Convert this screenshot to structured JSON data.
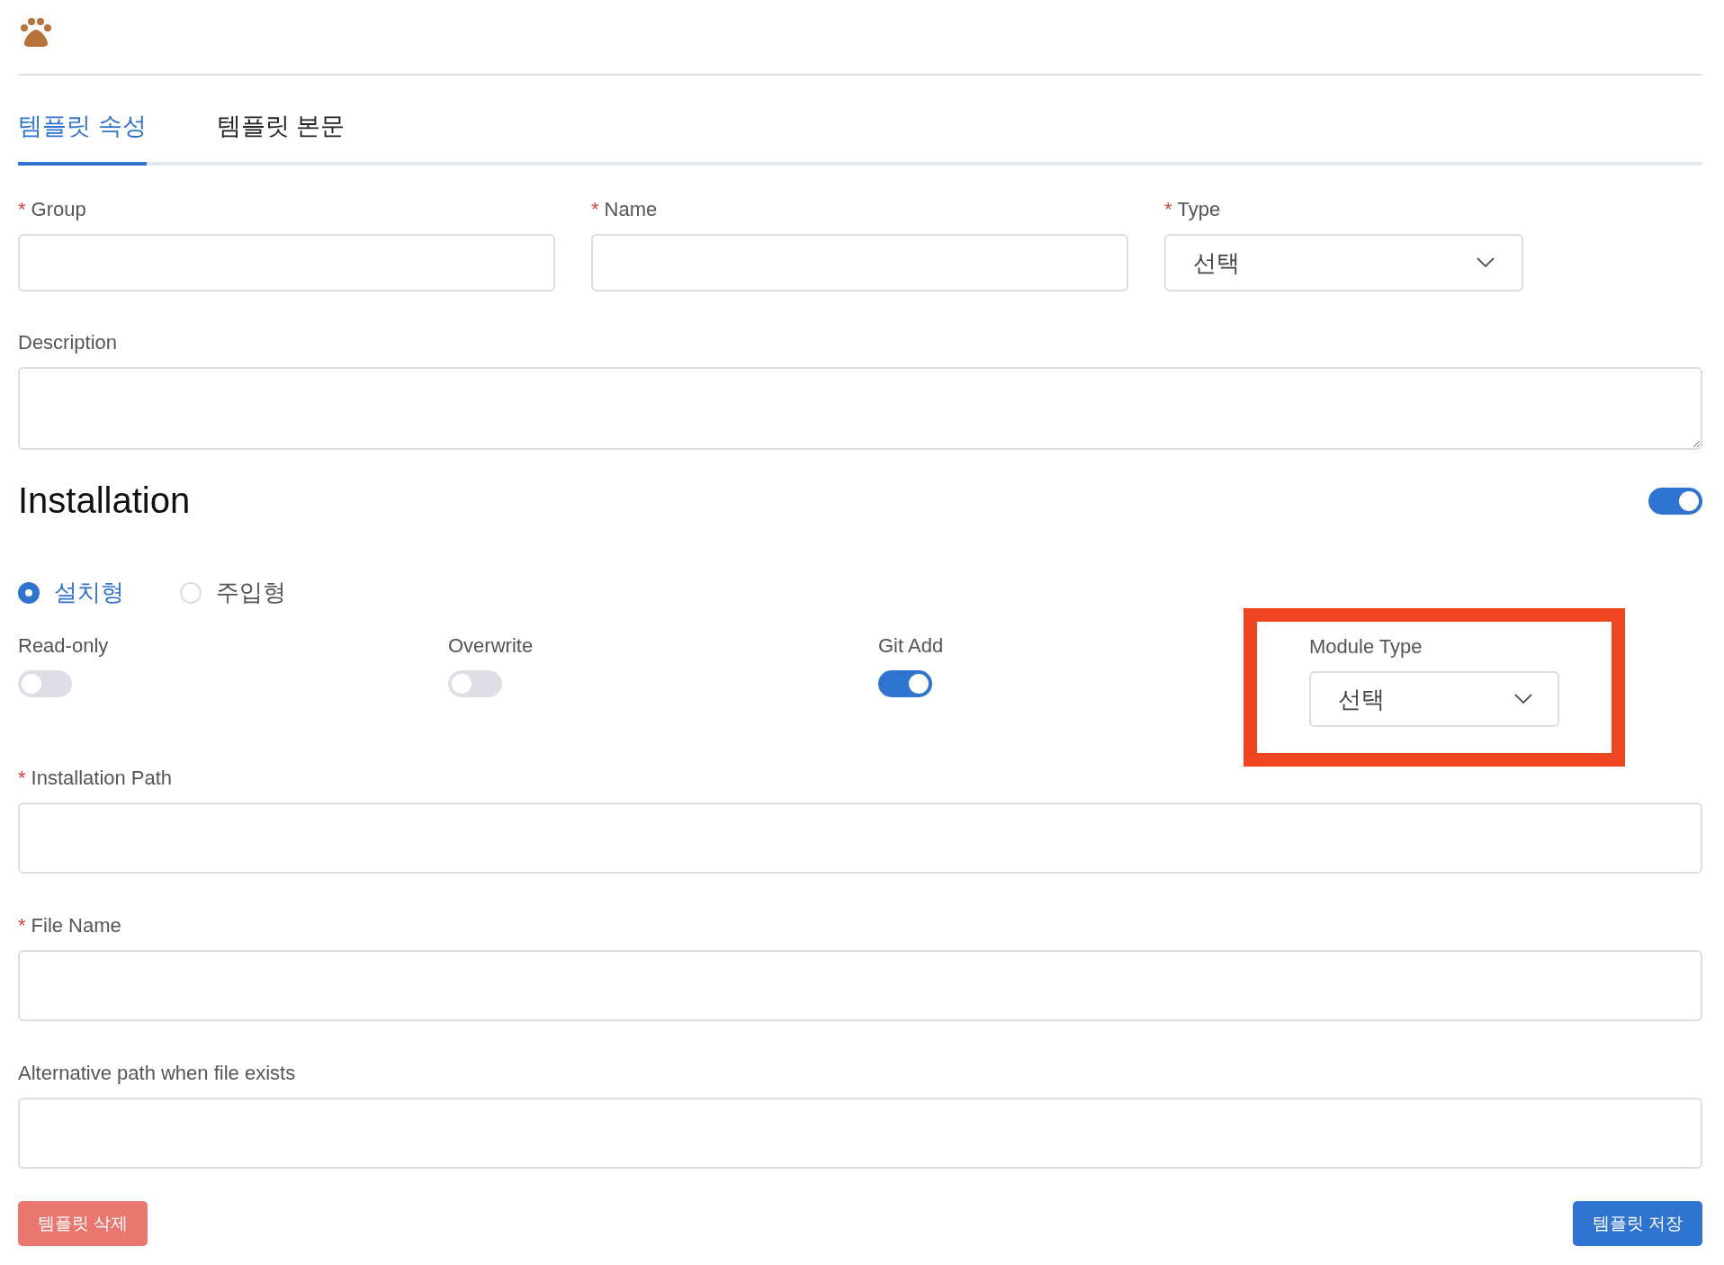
{
  "tabs": [
    {
      "label": "템플릿 속성",
      "selected": true
    },
    {
      "label": "템플릿 본문",
      "selected": false
    }
  ],
  "fields": [
    {
      "label": "Group",
      "required_mark": "*",
      "kind": "input"
    },
    {
      "label": "Name",
      "required_mark": "*",
      "kind": "input"
    },
    {
      "label": "Type",
      "required_mark": "*",
      "kind": "select",
      "value": "선택"
    }
  ],
  "description": {
    "label": "Description"
  },
  "installation": {
    "title": "Installation",
    "on": true,
    "modes": [
      {
        "label": "설치형",
        "selected": true
      },
      {
        "label": "주입형",
        "selected": false
      }
    ],
    "switches": [
      {
        "label": "Read-only",
        "on": false
      },
      {
        "label": "Overwrite",
        "on": false
      },
      {
        "label": "Git Add",
        "on": true
      }
    ],
    "module_type": {
      "label": "Module Type",
      "value": "선택"
    },
    "paths": [
      {
        "label": "Installation Path",
        "required_mark": "*"
      },
      {
        "label": "File Name",
        "required_mark": "*"
      },
      {
        "label": "Alternative path when file exists"
      }
    ]
  },
  "buttons": [
    {
      "label": "템플릿 삭제",
      "kind": "danger"
    },
    {
      "label": "템플릿 저장",
      "kind": "primary"
    }
  ]
}
